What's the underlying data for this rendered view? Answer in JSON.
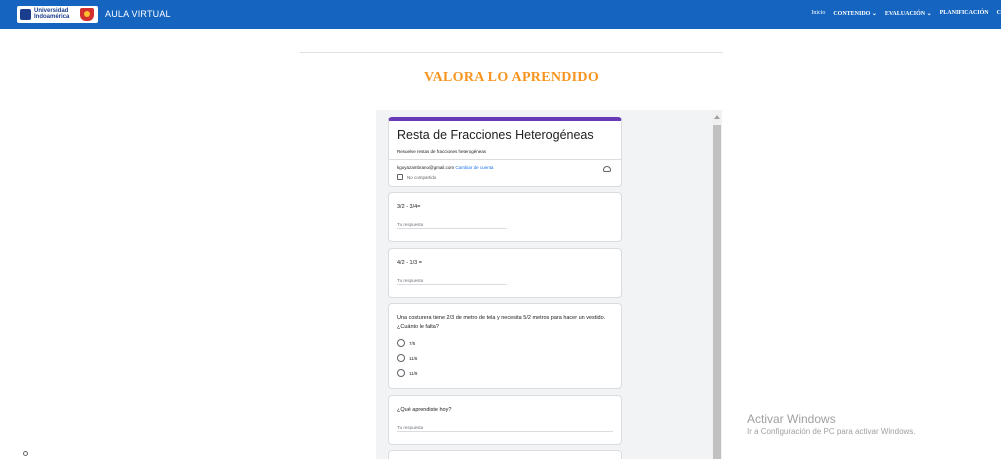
{
  "header": {
    "logo_text": "Universidad Indoamérica",
    "brand": "AULA VIRTUAL",
    "nav": {
      "inicio": "Inicio",
      "contenido": "CONTENIDO ⌄",
      "evaluacion": "EVALUACIÓN ⌄",
      "planificacion": "PLANIFICACIÓN",
      "extra": "C"
    },
    "colors": {
      "bar": "#1565c0",
      "accent": "#f7941d",
      "form_accent": "#673ab7"
    }
  },
  "page": {
    "section_title": "VALORA LO APRENDIDO"
  },
  "form": {
    "title": "Resta de Fracciones Heterogéneas",
    "description": "Resuelve restas de fracciones heterogéneas",
    "account_email": "kgoyazambrano@gmail.com",
    "switch_account": "Cambiar de cuenta",
    "not_shared": "No compartido",
    "questions": [
      {
        "text": "3/2 - 3/4=",
        "placeholder": "Tu respuesta"
      },
      {
        "text": "4/2 - 1/3 =",
        "placeholder": "Tu respuesta"
      },
      {
        "text": "Una costurera tiene 2/3 de metro de tela y necesita 5/2 metros para hacer un vestido.¿Cuánto le falta?",
        "options": [
          "7/5",
          "11/6",
          "11/9"
        ]
      },
      {
        "text": "¿Qué aprendiste hoy?",
        "placeholder": "Tu respuesta"
      }
    ]
  },
  "watermark": {
    "title": "Activar Windows",
    "subtitle": "Ir a Configuración de PC para activar Windows."
  }
}
